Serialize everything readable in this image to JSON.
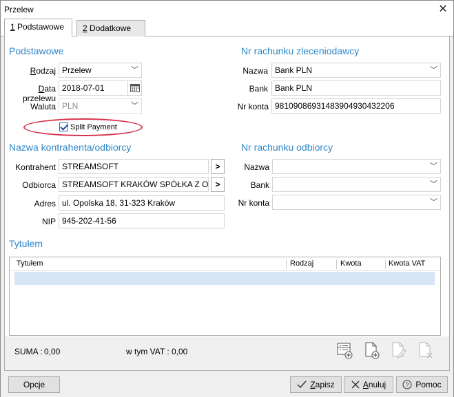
{
  "window": {
    "title": "Przelew",
    "close_glyph": "✕"
  },
  "tabs": [
    {
      "num": "1",
      "label": " Podstawowe"
    },
    {
      "num": "2",
      "label": " Dodatkowe"
    }
  ],
  "basic": {
    "title": "Podstawowe",
    "rodzaj_label_u": "R",
    "rodzaj_label_rest": "odzaj",
    "rodzaj_value": "Przelew",
    "data_label_u": "D",
    "data_label_rest": "ata przelewu",
    "data_value": "2018-07-01",
    "waluta_label": "Waluta",
    "waluta_value": "PLN",
    "split_payment_label": "Split Payment"
  },
  "sender_account": {
    "title": "Nr rachunku zleceniodawcy",
    "nazwa_label": "Nazwa",
    "nazwa_value": "Bank PLN",
    "bank_label": "Bank",
    "bank_value": "Bank PLN",
    "nrkonta_label": "Nr konta",
    "nrkonta_value": "98109086931483904930432206"
  },
  "counterparty": {
    "title": "Nazwa kontrahenta/odbiorcy",
    "kontrahent_label": "Kontrahent",
    "kontrahent_value": "STREAMSOFT",
    "odbiorca_label": "Odbiorca",
    "odbiorca_value": "STREAMSOFT KRAKÓW SPÓŁKA Z OGRANICZONĄ",
    "adres_label": "Adres",
    "adres_value": "ul. Opolska 18, 31-323 Kraków",
    "nip_label": "NIP",
    "nip_value": "945-202-41-56",
    "more_glyph": ">"
  },
  "recipient_account": {
    "title": "Nr rachunku odbiorcy",
    "nazwa_label": "Nazwa",
    "nazwa_value": "",
    "bank_label": "Bank",
    "bank_value": "",
    "nrkonta_label": "Nr konta",
    "nrkonta_value": ""
  },
  "titles": {
    "title": "Tytułem",
    "columns": [
      "Tytułem",
      "Rodzaj",
      "Kwota",
      "Kwota VAT"
    ]
  },
  "summary": {
    "suma_label": "SUMA :",
    "suma_value": "0,00",
    "vat_label": "w tym VAT :",
    "vat_value": "0,00"
  },
  "icons": {
    "dropdown": "chevron-down-icon",
    "calendar": "calendar-icon",
    "toolbar": [
      "add-from-list-icon",
      "add-document-icon",
      "edit-document-icon",
      "delete-document-icon"
    ]
  },
  "buttons": {
    "opcje": "Opcje",
    "zapisz_u": "Z",
    "zapisz_rest": "apisz",
    "anuluj_u": "A",
    "anuluj_rest": "nuluj",
    "pomoc": "Pomoc"
  },
  "colors": {
    "section_title": "#2f87c8",
    "highlight_ellipse": "#d6334a",
    "selected_row": "#d6e6f5"
  }
}
